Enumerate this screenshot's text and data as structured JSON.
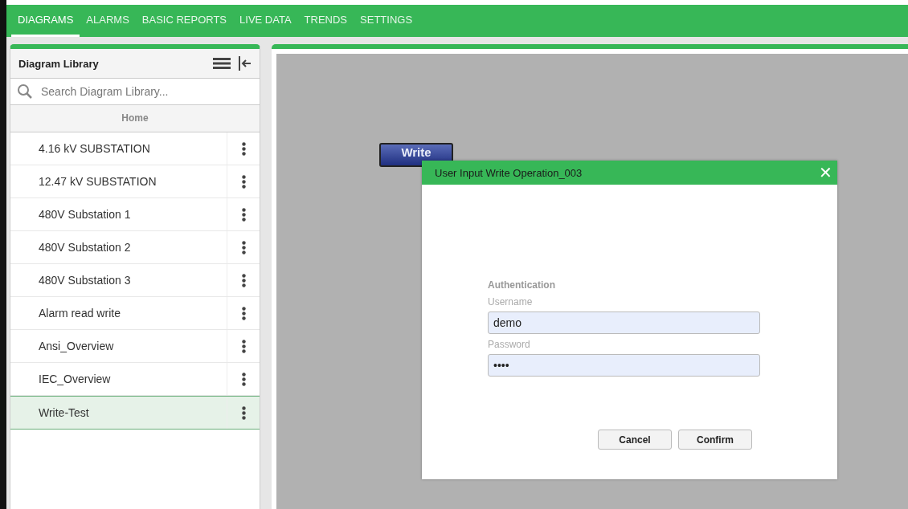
{
  "nav_tabs": [
    {
      "label": "DIAGRAMS",
      "selected": true
    },
    {
      "label": "ALARMS",
      "selected": false
    },
    {
      "label": "BASIC REPORTS",
      "selected": false
    },
    {
      "label": "LIVE DATA",
      "selected": false
    },
    {
      "label": "TRENDS",
      "selected": false
    },
    {
      "label": "SETTINGS",
      "selected": false
    }
  ],
  "library": {
    "title": "Diagram Library",
    "search": {
      "placeholder": "Search Diagram Library..."
    },
    "breadcrumb": "Home",
    "items": [
      {
        "label": "4.16 kV SUBSTATION",
        "selected": false
      },
      {
        "label": "12.47 kV SUBSTATION",
        "selected": false
      },
      {
        "label": "480V Substation 1",
        "selected": false
      },
      {
        "label": "480V Substation 2",
        "selected": false
      },
      {
        "label": "480V Substation 3",
        "selected": false
      },
      {
        "label": "Alarm read write",
        "selected": false
      },
      {
        "label": "Ansi_Overview",
        "selected": false
      },
      {
        "label": "IEC_Overview",
        "selected": false
      },
      {
        "label": "Write-Test",
        "selected": true
      }
    ]
  },
  "canvas": {
    "write_button": "Write"
  },
  "dialog": {
    "title": "User Input Write Operation_003",
    "close": "✕",
    "section": "Authentication",
    "fields": [
      {
        "label": "Username",
        "value": "demo"
      },
      {
        "label": "Password",
        "value": "••••"
      }
    ],
    "buttons": [
      "Cancel",
      "Confirm"
    ]
  }
}
